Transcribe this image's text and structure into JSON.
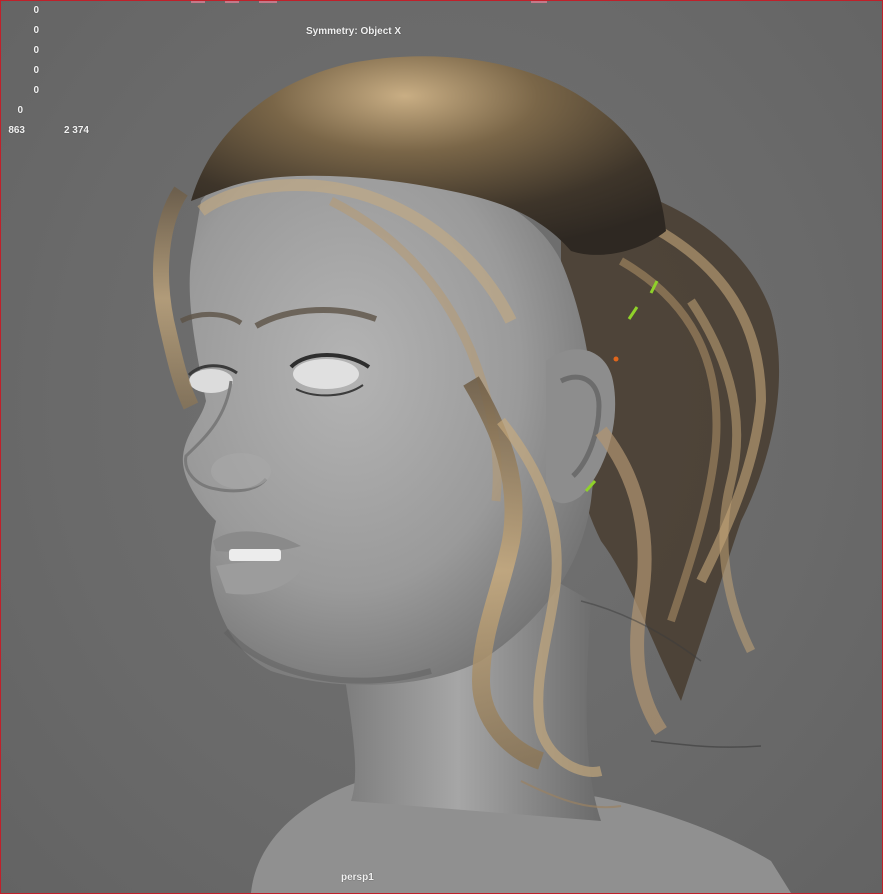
{
  "viewport": {
    "symmetry_label": "Symmetry: Object X",
    "camera_name": "persp1",
    "hud_values": [
      "0",
      "0",
      "0",
      "0",
      "0",
      "0",
      "863",
      "2 374"
    ]
  },
  "colors": {
    "background": "#6b6b6b",
    "border": "#c0202a",
    "skin": "#9a9a9a",
    "hair": "#b09470",
    "selection_green": "#8fd12a"
  },
  "icons": {
    "scene": "head-sculpt-render"
  }
}
